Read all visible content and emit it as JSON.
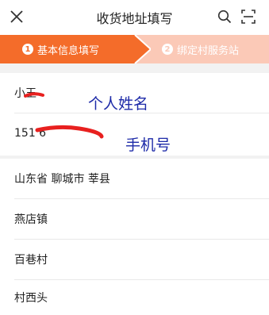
{
  "header": {
    "title": "收货地址填写",
    "close_icon": "close-icon",
    "search_icon": "search-icon",
    "scan_icon": "scan-icon"
  },
  "steps": [
    {
      "num": "1",
      "label": "基本信息填写",
      "active": true
    },
    {
      "num": "2",
      "label": "绑定村服务站",
      "active": false
    }
  ],
  "colors": {
    "accent": "#f46c2a",
    "inactive_step": "#fbc9b7",
    "annotation": "#1d2aa8",
    "redaction": "#e8201f"
  },
  "form": {
    "name_value": "小王",
    "phone_value": "151 6",
    "region_value": "山东省 聊城市 莘县",
    "town_value": "燕店镇",
    "village_value": "百巷村",
    "detail_value": "村西头"
  },
  "annotations": {
    "name_note": "个人姓名",
    "phone_note": "手机号"
  }
}
